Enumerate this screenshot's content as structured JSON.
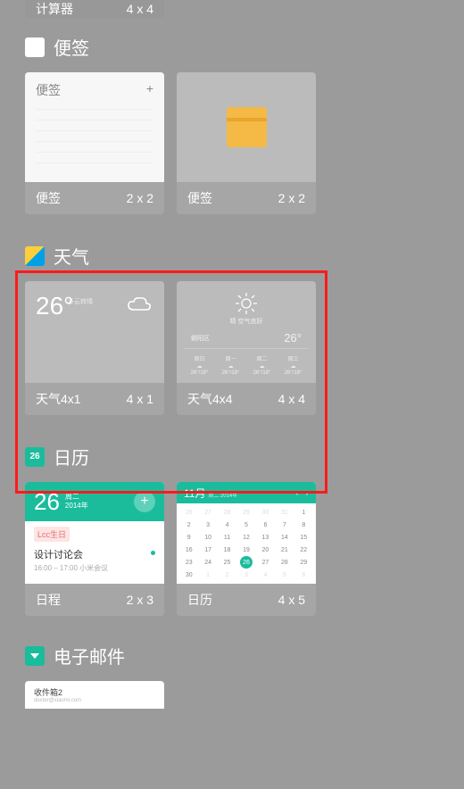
{
  "calculator": {
    "name": "计算器",
    "size": "4 x 4"
  },
  "notes": {
    "section_title": "便签",
    "widgets": [
      {
        "preview_title": "便签",
        "name": "便签",
        "size": "2 x 2"
      },
      {
        "name": "便签",
        "size": "2 x 2"
      }
    ]
  },
  "weather": {
    "section_title": "天气",
    "widgets": [
      {
        "temp": "26°",
        "sub": "多云转晴",
        "name": "天气4x1",
        "size": "4 x 1"
      },
      {
        "condition": "晴  空气良好",
        "temp": "26°",
        "location_line": "朝阳区",
        "forecast_days": [
          "周日",
          "周一",
          "周二",
          "周三"
        ],
        "forecast_lines": [
          "26°/18°",
          "26°/18°",
          "26°/18°",
          "26°/18°"
        ],
        "name": "天气4x4",
        "size": "4 x 4"
      }
    ]
  },
  "calendar": {
    "section_title": "日历",
    "icon_text": "26",
    "schedule_widget": {
      "date_num": "26",
      "date_weekday": "周二",
      "date_year": "2014年",
      "event1": "Lcc生日",
      "event2_title": "设计讨论会",
      "event2_time": "16:00 – 17:00    小米会议",
      "name": "日程",
      "size": "2 x 3"
    },
    "calendar_widget": {
      "month_title": "11月",
      "month_sub": "周二 2014年",
      "name": "日历",
      "size": "4 x 5"
    }
  },
  "email": {
    "section_title": "电子邮件",
    "preview_title": "收件箱2",
    "preview_sub": "dexter@xiaomi.com"
  }
}
